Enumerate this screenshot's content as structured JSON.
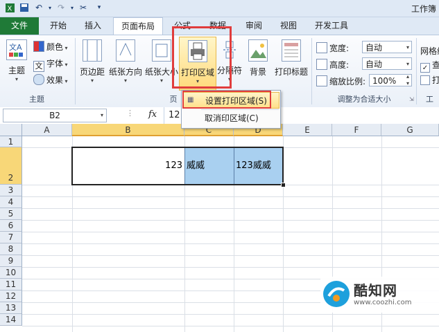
{
  "titlebar": {
    "app_title": "工作簿",
    "save_icon": "save-icon",
    "undo_icon": "undo-icon",
    "redo_icon": "redo-icon"
  },
  "tabs": [
    "文件",
    "开始",
    "插入",
    "页面布局",
    "公式",
    "数据",
    "审阅",
    "视图",
    "开发工具"
  ],
  "ribbon": {
    "theme_group": {
      "label": "主题",
      "themes_label": "主题",
      "colors_label": "颜色",
      "fonts_label": "字体",
      "effects_label": "效果"
    },
    "page_setup": {
      "label": "页",
      "margins": "页边距",
      "orientation": "纸张方向",
      "size": "纸张大小",
      "print_area": "打印区域",
      "breaks": "分隔符",
      "background": "背景",
      "print_titles": "打印标题"
    },
    "scale_group": {
      "label": "调整为合适大小",
      "width_label": "宽度:",
      "width_value": "自动",
      "height_label": "高度:",
      "height_value": "自动",
      "scale_label": "缩放比例:",
      "scale_value": "100%"
    },
    "sheet_options": {
      "gridlines_label": "网格线",
      "view_label": "查",
      "print_label": "打",
      "group_label": "工"
    }
  },
  "dropdown": {
    "set_print_area": "设置打印区域(S)",
    "clear_print_area": "取消印区域(C)"
  },
  "formula_bar": {
    "name_box": "B2",
    "fx": "fx",
    "formula_value": "12"
  },
  "columns": [
    "A",
    "B",
    "C",
    "D",
    "E",
    "F",
    "G"
  ],
  "rows": [
    "1",
    "2",
    "3",
    "4",
    "5",
    "6",
    "7",
    "8",
    "9",
    "10",
    "11",
    "12",
    "13",
    "14"
  ],
  "cells": {
    "B2": "123",
    "C2": "威威",
    "D2": "123威威"
  },
  "colors": {
    "file_tab": "#1f7a37",
    "selection_header": "#f8d778",
    "highlight_cell": "#a9d0f0",
    "red_callout": "#e03c3c"
  },
  "watermark": {
    "brand": "酷知网",
    "url": "www.coozhi.com"
  }
}
